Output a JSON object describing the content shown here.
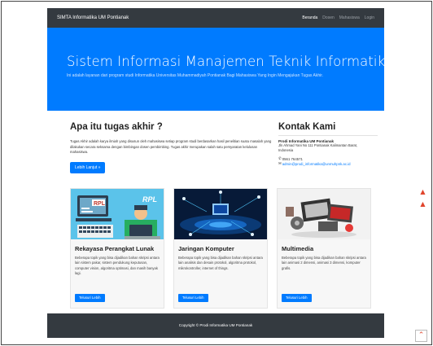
{
  "navbar": {
    "brand": "SIMTA Informatika UM Pontianak",
    "links": [
      "Beranda",
      "Dosen",
      "Mahasiswa",
      "Login"
    ]
  },
  "hero": {
    "title": "Sistem Informasi Manajemen Teknik Informatika",
    "subtitle": "Ini adalah layanan dari program studi Informatika Universitas Muhammadiyah Pontianak Bagi Mahasiswa Yang Ingin Mengajukan Tugas Akhir."
  },
  "about": {
    "heading": "Apa itu tugas akhir ?",
    "text": "Tugas Akhir adalah karya ilmiah yang disusun oleh mahasiswa setiap program studi berdasarkan hasil penelitian suatu masalah yang dilakukan secara seksama dengan bimbingan dosen pembimbing. Tugas akhir merupakan salah satu persyaratan kelulusan mahasiswa.",
    "button": "Lebih Lanjut »"
  },
  "contact": {
    "heading": "Kontak Kami",
    "org": "Prodi Informatika UM Pontianak",
    "address": "Jln Ahmad Yani No 111 Pontianak Kalimantan Barat, Indonesia",
    "phone": "0561 764571",
    "email": "admin@prodi_informatika@unmuhpnk.ac.id"
  },
  "cards": [
    {
      "title": "Rekayasa Perangkat Lunak",
      "text": "Beberapa topik yang bisa dijadikan bahan skripsi antara lain sistem pakar, sistem pendukung keputusan, computer vision, algoritma optimasi, dan masih banyak lagi.",
      "button": "Telusuri Lebih",
      "image_text": "RPL"
    },
    {
      "title": "Jaringan Komputer",
      "text": "Beberapa topik yang bisa dijadikan bahan skripsi antara lain analisis dan desain protokol, algoritma protokol, mikrokontroller, internet of things.",
      "button": "Telusuri Lebih"
    },
    {
      "title": "Multimedia",
      "text": "Beberapa topik yang bisa dijadikan bahan skripsi antara lain animasi 2 dimensi, animasi 3 dimensi, komputer grafis.",
      "button": "Telusuri Lebih"
    }
  ],
  "footer": {
    "text": "Copyright © Prodi Informatika UM Pontianak"
  },
  "colors": {
    "primary": "#007bff",
    "dark": "#343a40"
  },
  "icons": {
    "phone": "phone-icon",
    "email": "envelope-icon",
    "scroll": "chevron-up-icon"
  }
}
